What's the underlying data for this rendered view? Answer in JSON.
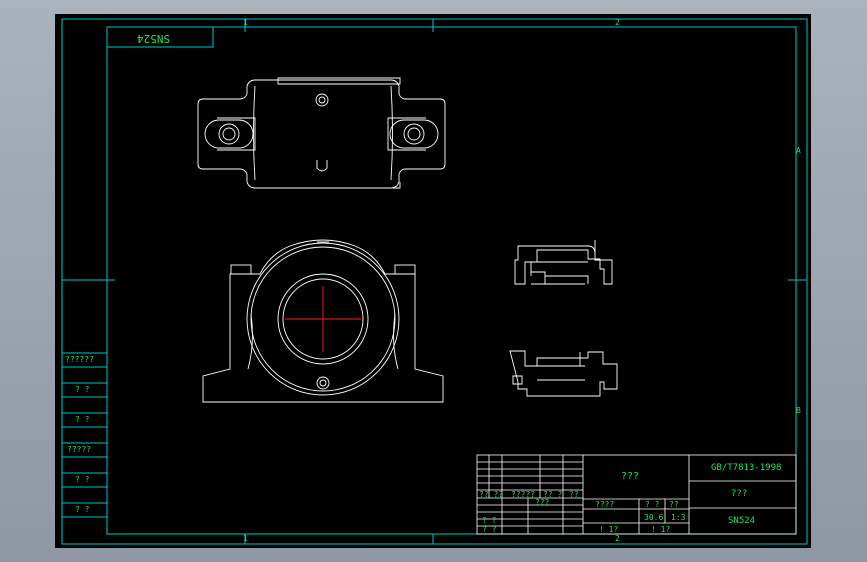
{
  "colors": {
    "frame": "#00c8c8",
    "drawing": "#ffffff",
    "text": "#20e060",
    "centerline": "#ff2020",
    "background": "#000000"
  },
  "frame_labels": {
    "top_left": "1",
    "top_right": "2",
    "bottom_left": "1",
    "bottom_right": "2",
    "right_upper": "A",
    "right_lower": "B"
  },
  "corner_stamp": "SN524",
  "side_block": [
    "??????",
    "? ?",
    "? ?",
    "?????",
    "? ?",
    "? ?"
  ],
  "title_block": {
    "title": "???",
    "standard": "GB/T7813-1998",
    "material": "???",
    "part_no": "SN524",
    "row_labels": [
      "?? ??",
      "?????",
      "?? ?",
      "??"
    ],
    "sign_labels": [
      "? ?",
      "???",
      "? ?"
    ],
    "scale_header": "????",
    "weight_header": "? ?",
    "ratio_header": "??",
    "weight_value": "30.6",
    "ratio_value": "1:3",
    "sheet_info": [
      "! 1?",
      "! 1?"
    ]
  }
}
